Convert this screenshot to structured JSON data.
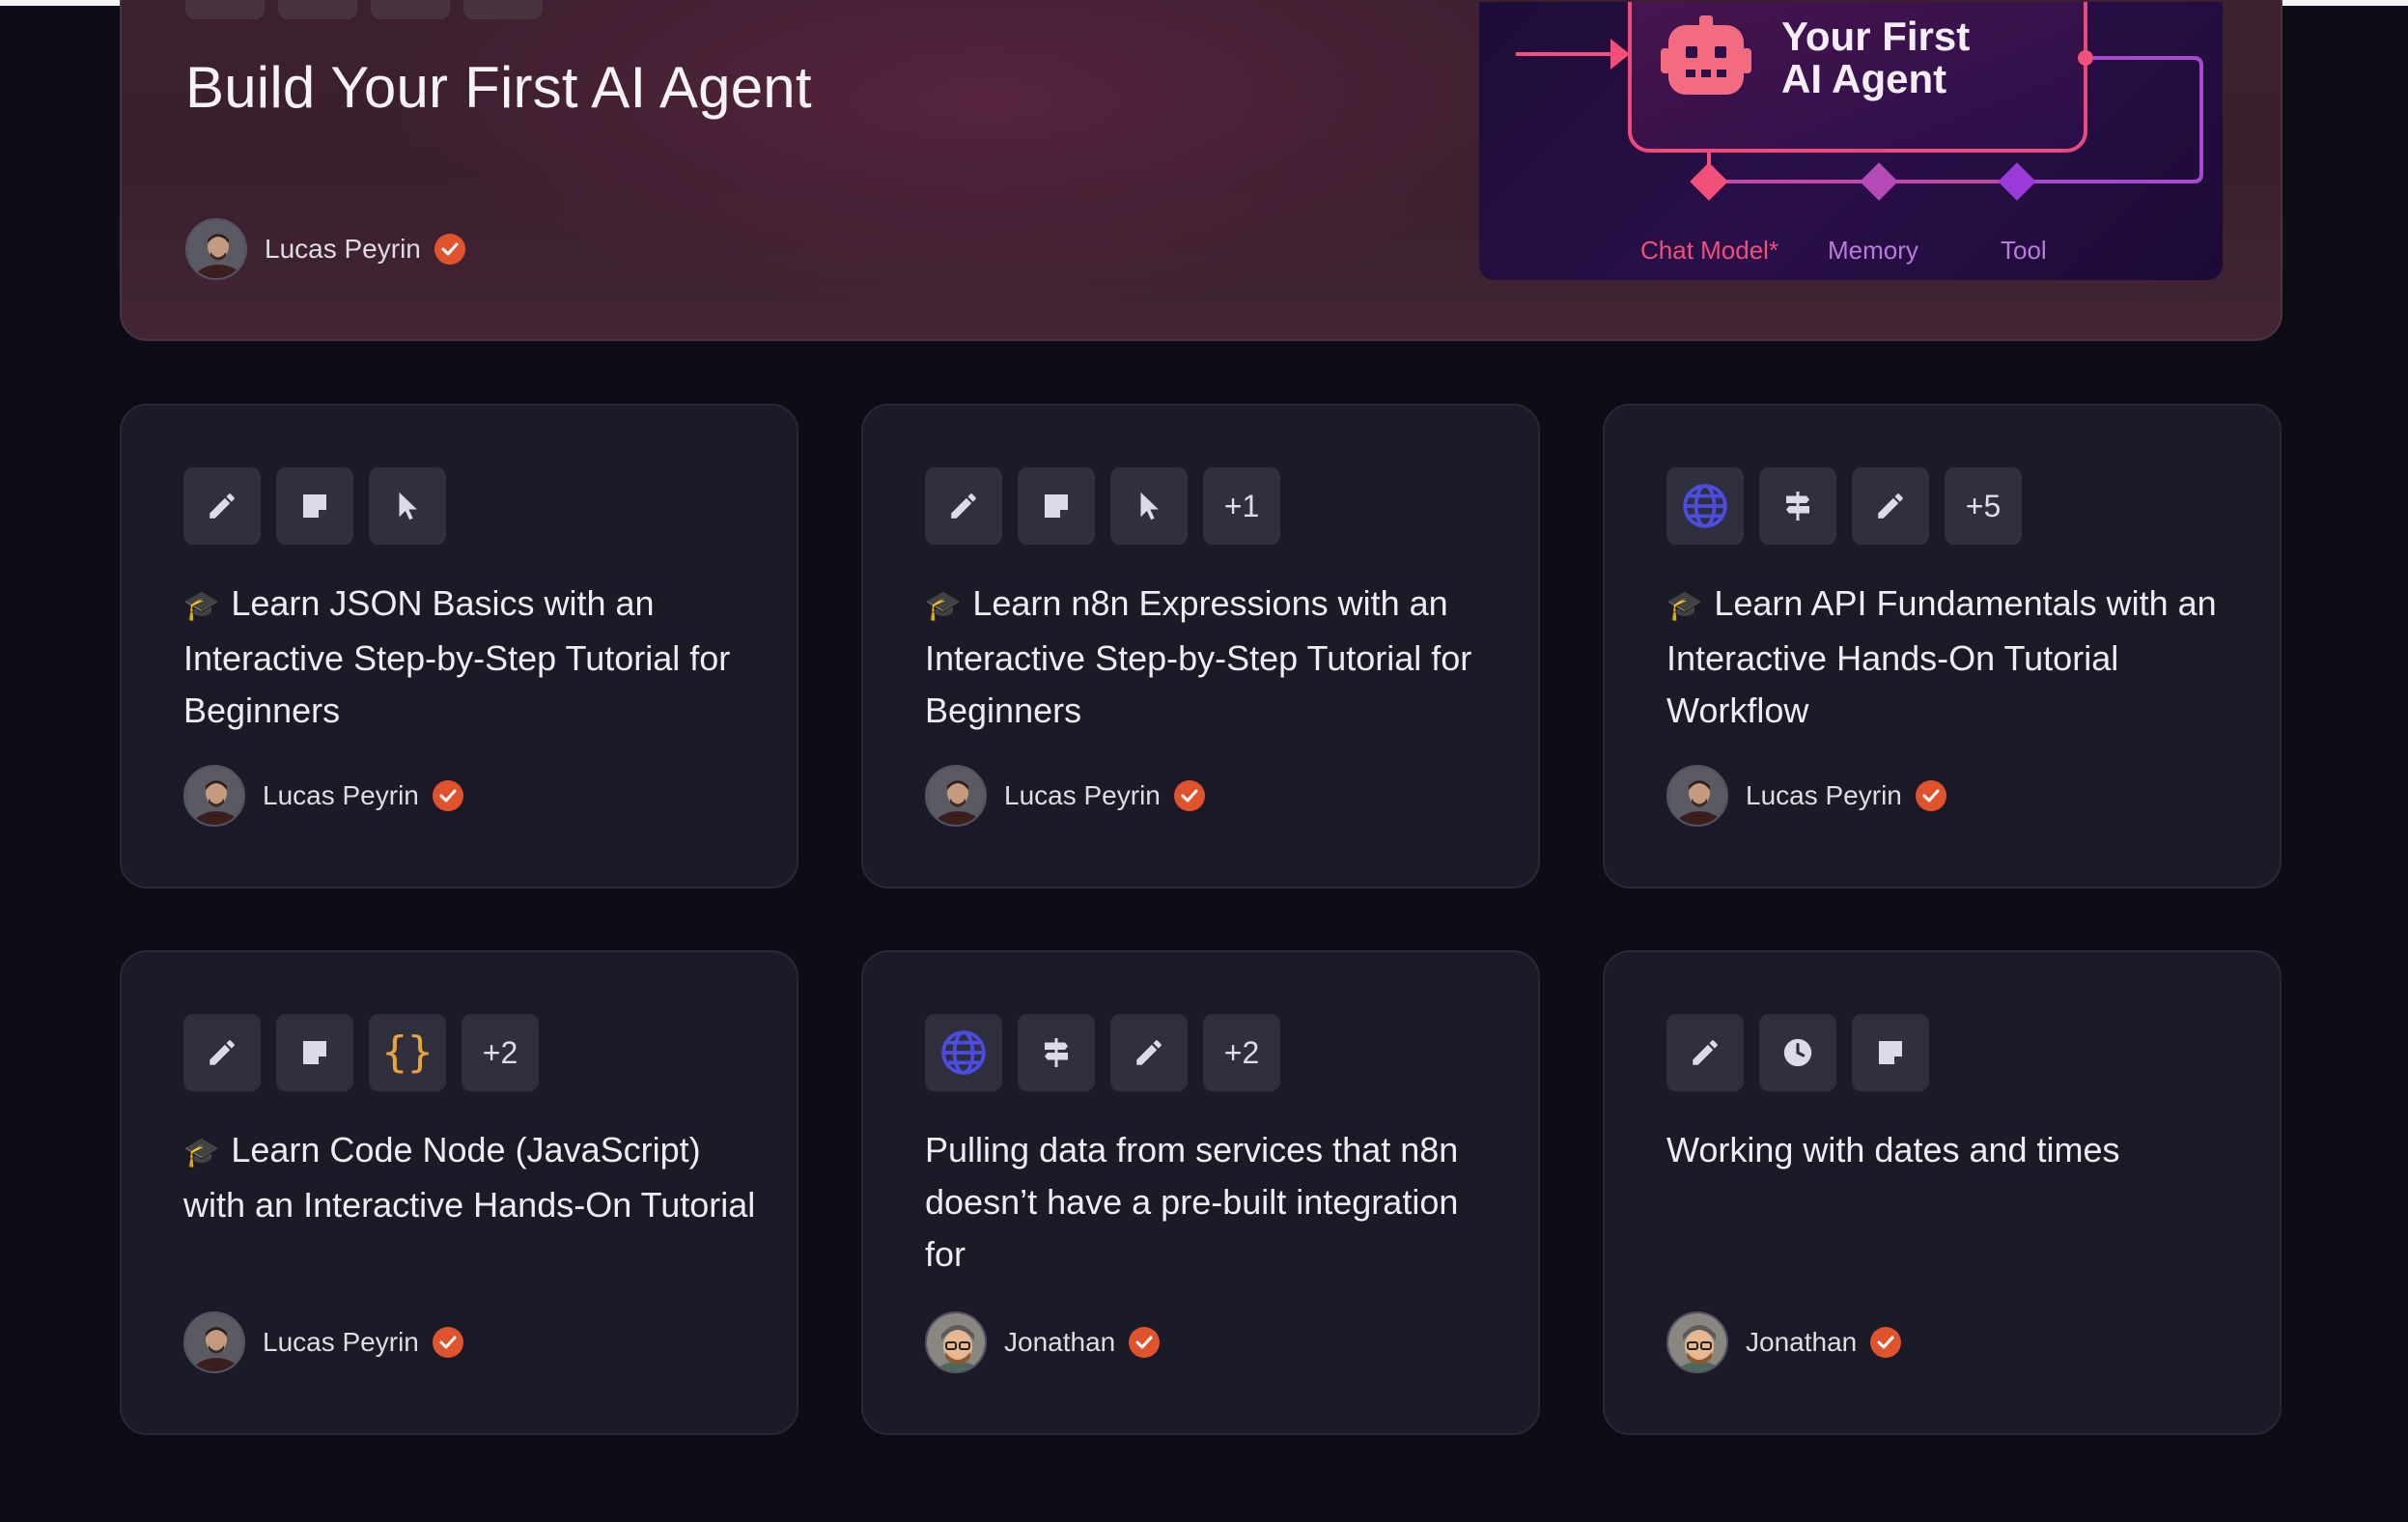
{
  "hero": {
    "title": "Build Your First AI Agent",
    "author": "Lucas Peyrin",
    "illustration": {
      "title_line1": "Your First",
      "title_line2": "AI Agent",
      "inputs": [
        "Chat Model*",
        "Memory",
        "Tool"
      ]
    }
  },
  "cards": [
    {
      "icons": [
        "pencil-icon",
        "sticky-note-icon",
        "cursor-icon"
      ],
      "extra": "",
      "title": "Learn JSON Basics with an Interactive Step-by-Step Tutorial for Beginners",
      "emoji": "🎓",
      "author": "Lucas Peyrin"
    },
    {
      "icons": [
        "pencil-icon",
        "sticky-note-icon",
        "cursor-icon"
      ],
      "extra": "+1",
      "title": "Learn n8n Expressions with an Interactive Step-by-Step Tutorial for Beginners",
      "emoji": "🎓",
      "author": "Lucas Peyrin"
    },
    {
      "icons": [
        "globe-icon",
        "signpost-icon",
        "pencil-icon"
      ],
      "extra": "+5",
      "title": "Learn API Fundamentals with an Interactive Hands-On Tutorial Workflow",
      "emoji": "🎓",
      "author": "Lucas Peyrin"
    },
    {
      "icons": [
        "pencil-icon",
        "sticky-note-icon",
        "code-braces-icon"
      ],
      "extra": "+2",
      "title": "Learn Code Node (JavaScript) with an Interactive Hands-On Tutorial",
      "emoji": "🎓",
      "author": "Lucas Peyrin"
    },
    {
      "icons": [
        "globe-icon",
        "signpost-icon",
        "pencil-icon"
      ],
      "extra": "+2",
      "title": "Pulling data from services that n8n doesn’t have a pre-built integration for",
      "emoji": "",
      "author": "Jonathan"
    },
    {
      "icons": [
        "pencil-icon",
        "clock-icon",
        "sticky-note-icon"
      ],
      "extra": "",
      "title": "Working with dates and times",
      "emoji": "",
      "author": "Jonathan"
    }
  ],
  "colors": {
    "page_bg": "#0e0c17",
    "card_bg": "#1b1a27",
    "verified_badge": "#e0542d",
    "globe_icon": "#4b4de0",
    "code_icon": "#e8a33a"
  }
}
